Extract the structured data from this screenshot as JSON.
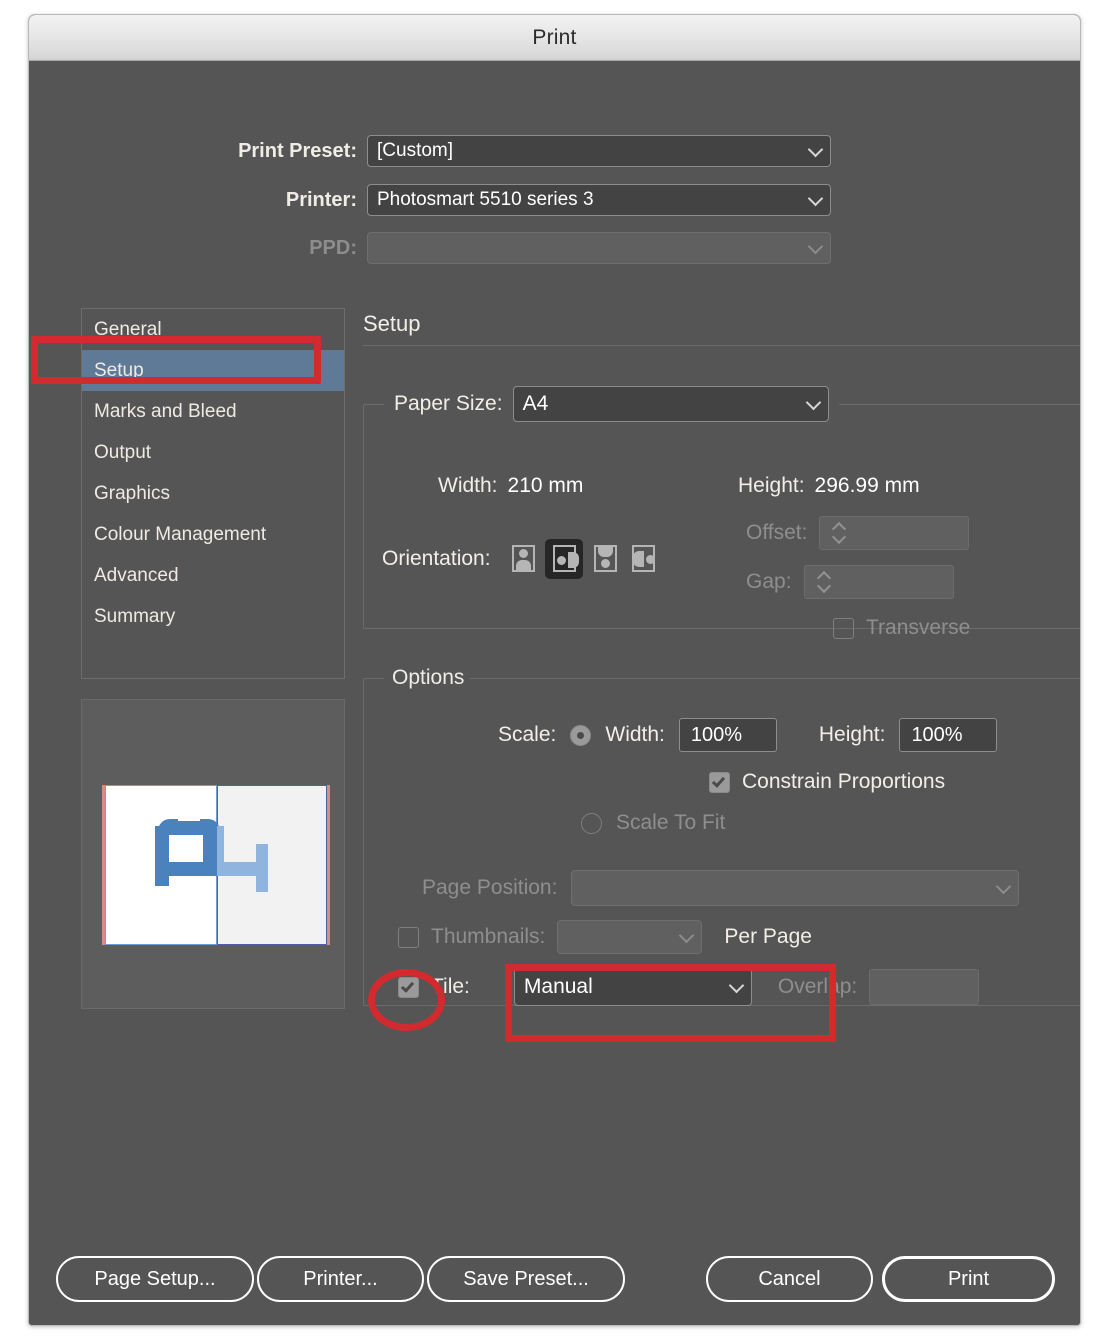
{
  "window": {
    "title": "Print"
  },
  "top_form": {
    "print_preset": {
      "label": "Print Preset:",
      "value": "[Custom]"
    },
    "printer": {
      "label": "Printer:",
      "value": "Photosmart 5510 series 3"
    },
    "ppd": {
      "label": "PPD:",
      "value": ""
    }
  },
  "sidebar": {
    "items": [
      {
        "label": "General",
        "selected": false
      },
      {
        "label": "Setup",
        "selected": true
      },
      {
        "label": "Marks and Bleed",
        "selected": false
      },
      {
        "label": "Output",
        "selected": false
      },
      {
        "label": "Graphics",
        "selected": false
      },
      {
        "label": "Colour Management",
        "selected": false
      },
      {
        "label": "Advanced",
        "selected": false
      },
      {
        "label": "Summary",
        "selected": false
      }
    ]
  },
  "panel": {
    "title": "Setup",
    "setup_group": {
      "legend": "",
      "paper_size": {
        "label": "Paper Size:",
        "value": "A4"
      },
      "width": {
        "label": "Width:",
        "value": "210 mm"
      },
      "height": {
        "label": "Height:",
        "value": "296.99 mm"
      },
      "orientation": {
        "label": "Orientation:",
        "options": [
          "portrait",
          "landscape",
          "portrait-rotated",
          "landscape-rotated"
        ],
        "selected_index": 1
      },
      "offset": {
        "label": "Offset:",
        "value": ""
      },
      "gap": {
        "label": "Gap:",
        "value": ""
      },
      "transverse": {
        "label": "Transverse",
        "checked": false
      }
    },
    "options_group": {
      "legend": "Options",
      "scale": {
        "label": "Scale:",
        "radio_checked": true
      },
      "scale_width": {
        "label": "Width:",
        "value": "100%"
      },
      "scale_height": {
        "label": "Height:",
        "value": "100%"
      },
      "constrain": {
        "label": "Constrain Proportions",
        "checked": true
      },
      "scale_to_fit": {
        "label": "Scale To Fit",
        "checked": false
      },
      "page_position": {
        "label": "Page Position:",
        "value": ""
      },
      "thumbnails": {
        "label": "Thumbnails:",
        "checked": false,
        "value": "",
        "suffix": "Per Page"
      },
      "tile": {
        "label": "Tile:",
        "checked": true,
        "value": "Manual"
      },
      "overlap": {
        "label": "Overlap:",
        "value": ""
      }
    }
  },
  "footer": {
    "page_setup": "Page Setup...",
    "printer": "Printer...",
    "save_preset": "Save Preset...",
    "cancel": "Cancel",
    "print": "Print"
  },
  "colors": {
    "window_bg": "#555555",
    "titlebar_top": "#f2f2f2",
    "selection_blue": "#5f7a96",
    "annotation_red": "#d32a2f",
    "art_blue": "#4a82bd",
    "art_blue_faded": "#8fb4dd"
  }
}
